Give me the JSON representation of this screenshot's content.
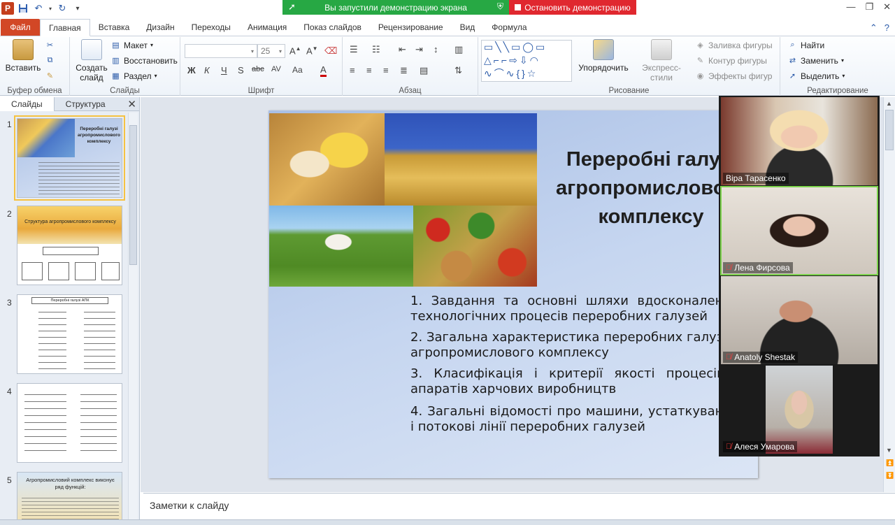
{
  "share": {
    "running_text": "Вы запустили демонстрацию экрана",
    "stop_text": "Остановить демонстрацию"
  },
  "tabs": [
    "Файл",
    "Главная",
    "Вставка",
    "Дизайн",
    "Переходы",
    "Анимация",
    "Показ слайдов",
    "Рецензирование",
    "Вид",
    "Формула"
  ],
  "ribbon": {
    "clipboard": {
      "paste": "Вставить",
      "label": "Буфер обмена"
    },
    "slides": {
      "new_slide": "Создать слайд",
      "layout": "Макет",
      "reset": "Восстановить",
      "section": "Раздел",
      "label": "Слайды"
    },
    "font": {
      "size": "25",
      "label": "Шрифт",
      "bold": "Ж",
      "italic": "К",
      "underline": "Ч",
      "shadow": "S",
      "strike": "abc",
      "spacing": "AV",
      "case": "Aa"
    },
    "paragraph": {
      "label": "Абзац"
    },
    "drawing": {
      "arrange": "Упорядочить",
      "quick_styles": "Экспресс-стили",
      "fill": "Заливка фигуры",
      "outline": "Контур фигуры",
      "effects": "Эффекты фигур",
      "label": "Рисование"
    },
    "editing": {
      "find": "Найти",
      "replace": "Заменить",
      "select": "Выделить",
      "label": "Редактирование"
    }
  },
  "left_panel": {
    "tabs": [
      "Слайды",
      "Структура"
    ],
    "thumbs": [
      {
        "num": "1",
        "title": "Переробні галузі агропромислового комплексу"
      },
      {
        "num": "2",
        "title": "Структура агропромислового комплексу"
      },
      {
        "num": "3",
        "title": "Переробні галузі АПК"
      },
      {
        "num": "4",
        "title": ""
      },
      {
        "num": "5",
        "title": "Агропромисловий комплекс виконує ряд функцій:"
      }
    ]
  },
  "slide": {
    "title_lines": [
      "Переробні галузі",
      "агропромислового",
      "комплексу"
    ],
    "items": [
      "1. Завдання та основні шляхи вдосконалення технологічних процесів переробних галузей",
      "2. Загальна характеристика переробних галузей агропромислового комплексу",
      "3. Класифікація і критерії якості процесів і апаратів харчових виробництв",
      "4. Загальні відомості про машини, устаткування і потокові лінії переробних галузей"
    ]
  },
  "notes_placeholder": "Заметки к слайду",
  "participants": [
    {
      "name": "Віра Тарасенко",
      "muted": false
    },
    {
      "name": "Лена Фирсова",
      "muted": true
    },
    {
      "name": "Anatoly Shestak",
      "muted": true
    },
    {
      "name": "Алеся Умарова",
      "muted": true
    }
  ],
  "colors": {
    "share_green": "#27a844",
    "share_red": "#e0282f",
    "file_tab": "#d24726"
  }
}
